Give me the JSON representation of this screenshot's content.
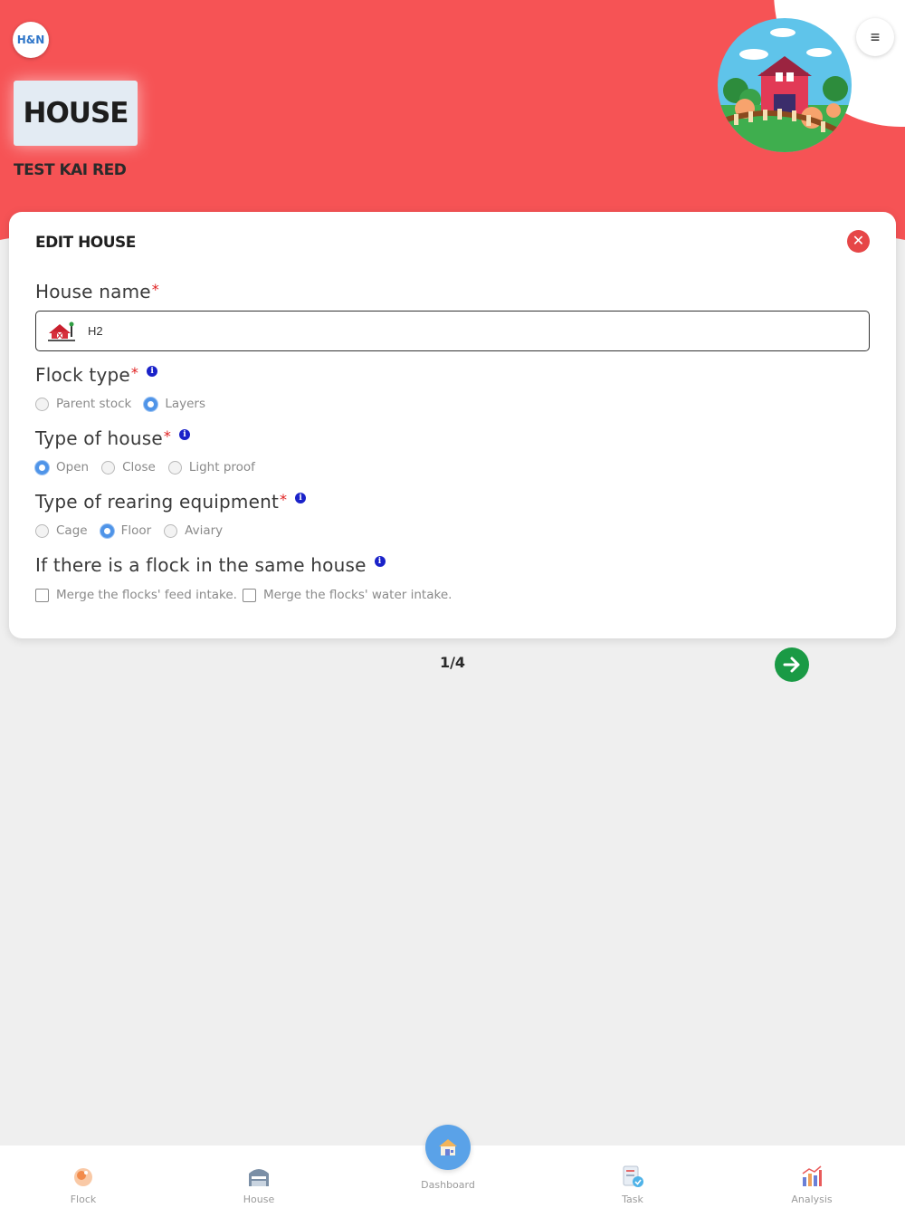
{
  "header": {
    "logo_text": "H&N",
    "title": "HOUSE",
    "subtitle": "TEST KAI RED",
    "menu_icon": "≡"
  },
  "card": {
    "title": "EDIT HOUSE",
    "close_icon": "✕",
    "house_name": {
      "label": "House name",
      "required": "*",
      "value": "H2"
    },
    "flock_type": {
      "label": "Flock type",
      "required": "*",
      "info": "i",
      "options": [
        "Parent stock",
        "Layers"
      ],
      "selected": "Layers"
    },
    "type_of_house": {
      "label": "Type of house",
      "required": "*",
      "info": "i",
      "options": [
        "Open",
        "Close",
        "Light proof"
      ],
      "selected": "Open"
    },
    "rearing_equipment": {
      "label": "Type of rearing equipment",
      "required": "*",
      "info": "i",
      "options": [
        "Cage",
        "Floor",
        "Aviary"
      ],
      "selected": "Floor"
    },
    "same_house": {
      "label": "If there is a flock in the same house",
      "info": "i",
      "checkboxes": [
        "Merge the flocks' feed intake.",
        "Merge the flocks' water intake."
      ]
    }
  },
  "pager": {
    "text": "1/4"
  },
  "nav": {
    "items": [
      {
        "label": "Flock",
        "icon": "flock-icon"
      },
      {
        "label": "House",
        "icon": "house-icon"
      },
      {
        "label": "Dashboard",
        "icon": "dashboard-icon"
      },
      {
        "label": "Task",
        "icon": "task-icon"
      },
      {
        "label": "Analysis",
        "icon": "analysis-icon"
      }
    ]
  },
  "colors": {
    "header_red": "#f65355",
    "radio_blue": "#4f94e8",
    "next_green": "#1a9a45",
    "close_red": "#e64647",
    "info_blue": "#1a22c9"
  }
}
